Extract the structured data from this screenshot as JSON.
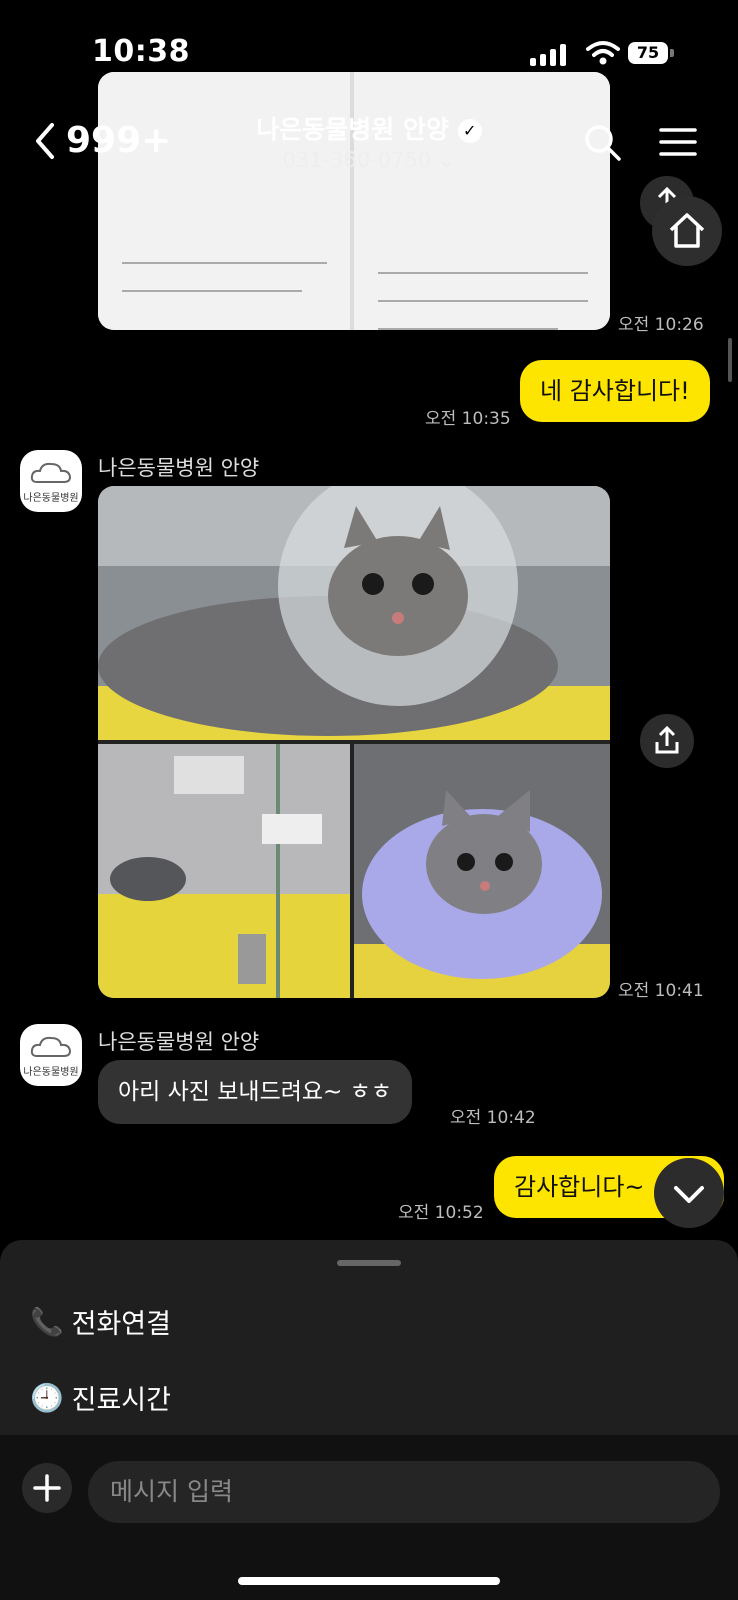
{
  "status": {
    "time": "10:38",
    "battery": "75"
  },
  "header": {
    "back_count": "999+",
    "title": "나은동물병원 안양",
    "phone": "031-360-0750"
  },
  "messages": {
    "m1_time": "오전 10:26",
    "m2_text": "네 감사합니다!",
    "m2_time": "오전 10:35",
    "m3_sender": "나은동물병원 안양",
    "m3_time": "오전 10:41",
    "m4_sender": "나은동물병원 안양",
    "m4_text": "아리 사진 보내드려요~ ㅎㅎ",
    "m4_time": "오전 10:42",
    "m5_text": "감사합니다~",
    "m5_time": "오전 10:52",
    "avatar_text": "나은동물병원"
  },
  "sheet": {
    "call": "전화연결",
    "hours": "진료시간"
  },
  "input": {
    "placeholder": "메시지 입력"
  }
}
